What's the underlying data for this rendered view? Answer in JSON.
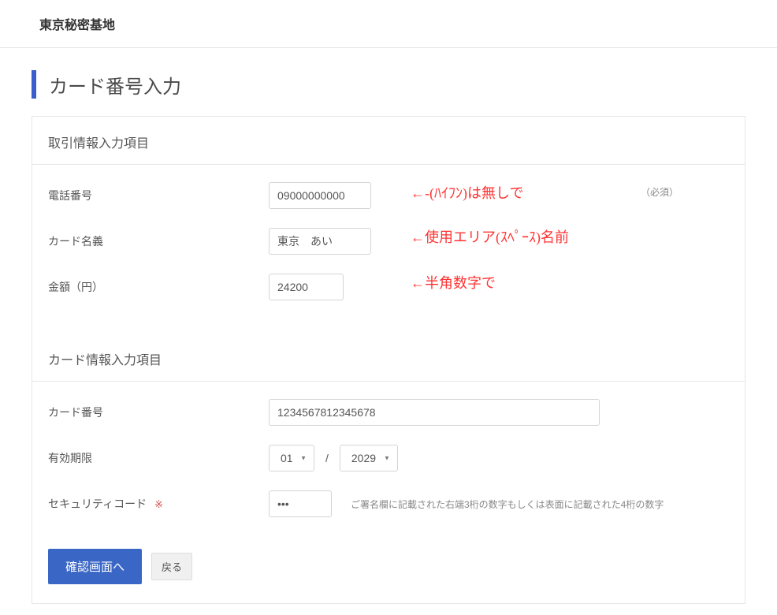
{
  "header": {
    "site_title": "東京秘密基地"
  },
  "page": {
    "title": "カード番号入力"
  },
  "sections": {
    "transaction": {
      "heading": "取引情報入力項目",
      "fields": {
        "phone": {
          "label": "電話番号",
          "value": "09000000000",
          "required_tag": "（必須）",
          "annotation": "←-(ﾊｲﾌﾝ)は無しで"
        },
        "cardname": {
          "label": "カード名義",
          "value": "東京　あい",
          "annotation": "←使用エリア(ｽﾍﾟｰｽ)名前"
        },
        "amount": {
          "label": "金額（円）",
          "value": "24200",
          "annotation": "←半角数字で"
        }
      }
    },
    "cardinfo": {
      "heading": "カード情報入力項目",
      "fields": {
        "cardnumber": {
          "label": "カード番号",
          "value": "1234567812345678"
        },
        "expiry": {
          "label": "有効期限",
          "month": "01",
          "year": "2029",
          "separator": "/"
        },
        "cvc": {
          "label": "セキュリティコード",
          "required_mark": "※",
          "value": "•••",
          "helper": "ご署名欄に記載された右端3桁の数字もしくは表面に記載された4桁の数字"
        }
      }
    }
  },
  "actions": {
    "confirm": "確認画面へ",
    "back": "戻る"
  }
}
